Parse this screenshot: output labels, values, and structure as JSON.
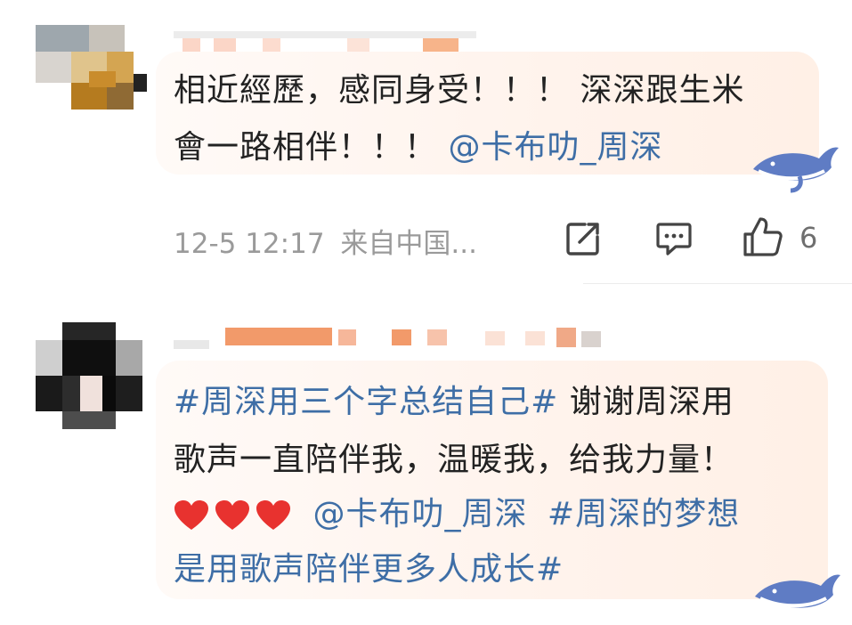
{
  "comments": [
    {
      "line1": "相近經歷，感同身受！！！ 深深跟生米",
      "line2_text": "會一路相伴！！！",
      "line2_mention": "@卡布叻_周深",
      "timestamp": "12-5 12:17",
      "source": "来自中国...",
      "like_count": "6",
      "icons": [
        "share-icon",
        "comment-icon",
        "like-icon"
      ]
    },
    {
      "line1_tag": "#周深用三个字总结自己#",
      "line1_text": "谢谢周深用",
      "line2": "歌声一直陪伴我，温暖我，给我力量！",
      "line3_mention": "@卡布叻_周深",
      "line3_tag": "#周深的梦想",
      "line4_tag": "是用歌声陪伴更多人成长#",
      "emoji": [
        "heart-emoji",
        "heart-emoji",
        "heart-emoji"
      ]
    }
  ],
  "colors": {
    "link": "#3e6ea6",
    "meta": "#9a9a9a",
    "bubble": "#fff3ec"
  }
}
